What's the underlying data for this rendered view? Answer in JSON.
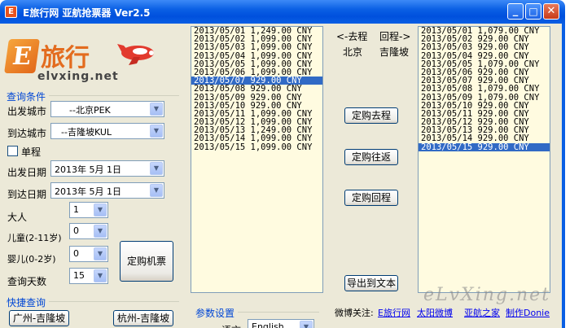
{
  "window": {
    "icon_letter": "E",
    "title": "E旅行网  亚航抢票器  Ver2.5",
    "minimize_glyph": "_",
    "maximize_glyph": "□",
    "close_glyph": "✕"
  },
  "logo": {
    "e_letter": "E",
    "brand_cn": "旅行",
    "brand_en": "elvxing.net"
  },
  "query": {
    "section_label": "查询条件",
    "depart_city_label": "出发城市",
    "depart_city_value": "--北京PEK",
    "arrive_city_label": "到达城市",
    "arrive_city_value": "--吉隆坡KUL",
    "one_way_label": "单程",
    "depart_date_label": "出发日期",
    "depart_date_value": "2013年 5月 1日",
    "arrive_date_label": "到达日期",
    "arrive_date_value": "2013年 5月 1日",
    "adult_label": "大人",
    "adult_value": "1",
    "child_label": "儿童(2-11岁)",
    "child_value": "0",
    "infant_label": "婴儿(0-2岁)",
    "infant_value": "0",
    "days_label": "查询天数",
    "days_value": "15",
    "book_button": "定购机票"
  },
  "quick": {
    "section_label": "快捷查询",
    "btn1": "广州-吉隆坡",
    "btn2": "杭州-吉隆坡"
  },
  "params": {
    "section_label": "参数设置",
    "lang_label": "语言",
    "lang_value": "English"
  },
  "outbound_list": {
    "selected_index": 6,
    "rows": [
      "2013/05/01 1,249.00 CNY",
      "2013/05/02 1,099.00 CNY",
      "2013/05/03 1,099.00 CNY",
      "2013/05/04 1,099.00 CNY",
      "2013/05/05 1,099.00 CNY",
      "2013/05/06 1,099.00 CNY",
      "2013/05/07 929.00 CNY",
      "2013/05/08 929.00 CNY",
      "2013/05/09 929.00 CNY",
      "2013/05/10 929.00 CNY",
      "2013/05/11 1,099.00 CNY",
      "2013/05/12 1,099.00 CNY",
      "2013/05/13 1,249.00 CNY",
      "2013/05/14 1,099.00 CNY",
      "2013/05/15 1,099.00 CNY"
    ]
  },
  "return_list": {
    "selected_index": 14,
    "rows": [
      "2013/05/01 1,079.00 CNY",
      "2013/05/02 929.00 CNY",
      "2013/05/03 929.00 CNY",
      "2013/05/04 929.00 CNY",
      "2013/05/05 1,079.00 CNY",
      "2013/05/06 929.00 CNY",
      "2013/05/07 929.00 CNY",
      "2013/05/08 1,079.00 CNY",
      "2013/05/09 1,079.00 CNY",
      "2013/05/10 929.00 CNY",
      "2013/05/11 929.00 CNY",
      "2013/05/12 929.00 CNY",
      "2013/05/13 929.00 CNY",
      "2013/05/14 929.00 CNY",
      "2013/05/15 929.00 CNY"
    ]
  },
  "middle": {
    "outbound_header": "<-去程",
    "return_header": "回程->",
    "origin_city": "北京",
    "dest_city": "吉隆坡",
    "btn_outbound": "定购去程",
    "btn_roundtrip": "定购往返",
    "btn_return": "定购回程",
    "btn_export": "导出到文本"
  },
  "footer": {
    "weibo_label": "微博关注:",
    "link1": "E旅行网",
    "link2": "太阳微博",
    "link3": "亚航之家",
    "link4": "制作Donie"
  },
  "watermark": "eLvXing.net",
  "colors": {
    "titlebar": "#0a5fe4",
    "list_bg": "#fffbe0",
    "selection": "#316ac5",
    "brand_orange": "#e36c1f"
  }
}
